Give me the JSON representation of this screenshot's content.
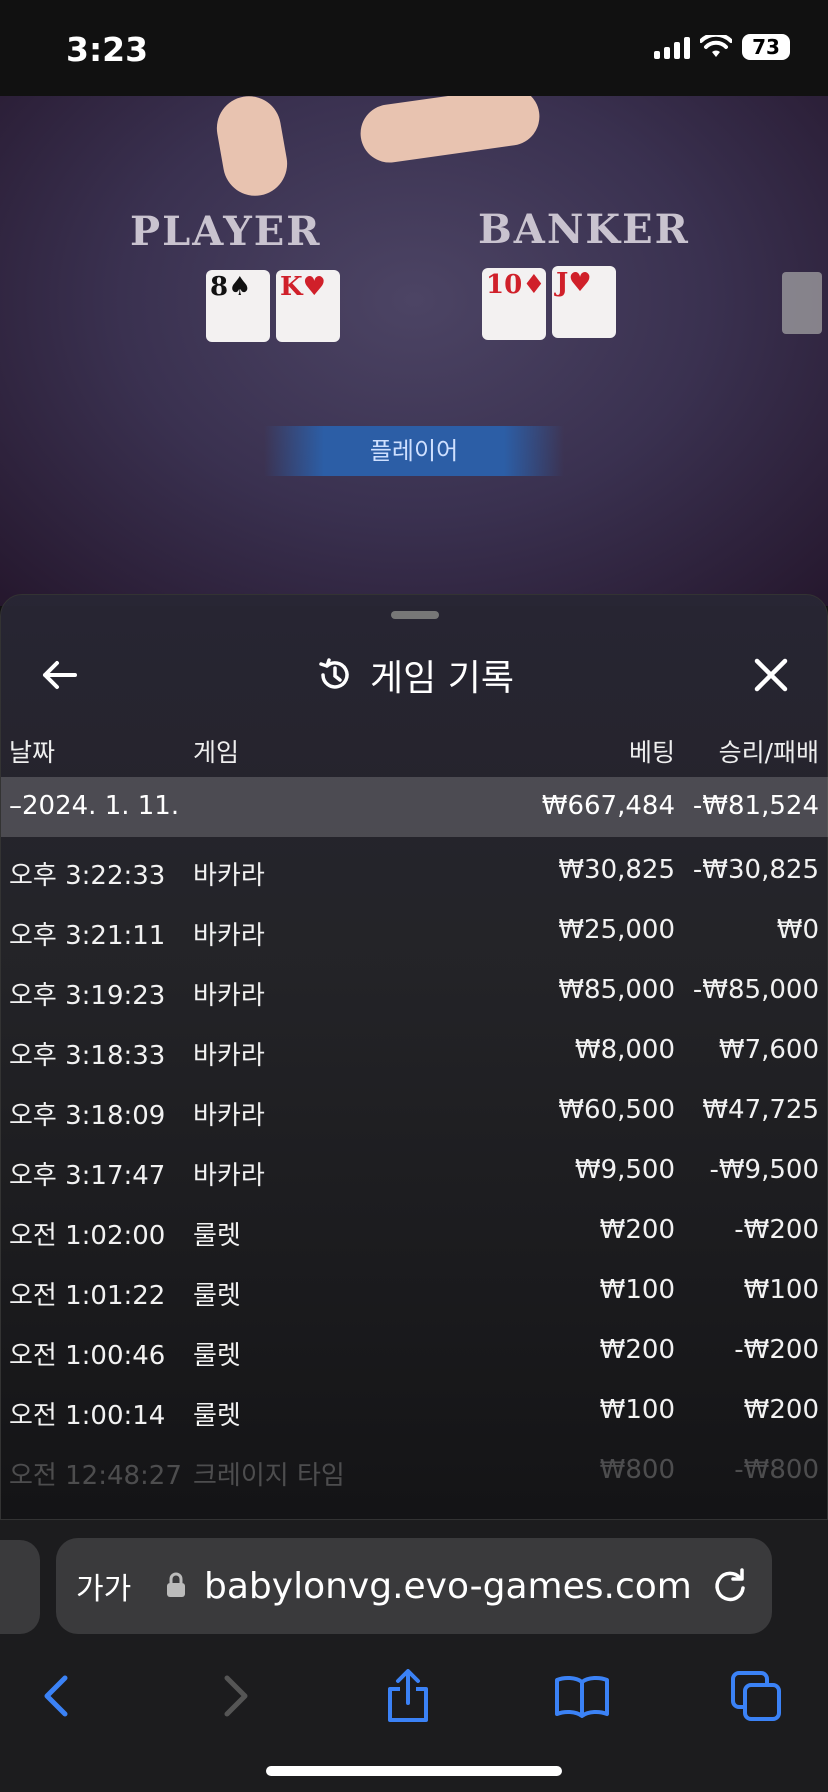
{
  "status": {
    "time": "3:23",
    "battery": "73"
  },
  "video": {
    "player_label": "PLAYER",
    "banker_label": "BANKER",
    "player_cards": [
      {
        "rank": "8",
        "suit": "♠",
        "red": false
      },
      {
        "rank": "K",
        "suit": "♥",
        "red": true
      }
    ],
    "banker_cards": [
      {
        "rank": "10",
        "suit": "♦",
        "red": true
      },
      {
        "rank": "J",
        "suit": "♥",
        "red": true
      }
    ],
    "result": "플레이어"
  },
  "panel": {
    "title": "게임 기록",
    "columns": {
      "date": "날짜",
      "game": "게임",
      "bet": "베팅",
      "winloss": "승리/패배"
    },
    "summary": {
      "date": "–2024. 1. 11.",
      "bet": "₩667,484",
      "winloss": "-₩81,524"
    },
    "rows": [
      {
        "date": "오후 3:22:33",
        "game": "바카라",
        "bet": "₩30,825",
        "winloss": "-₩30,825"
      },
      {
        "date": "오후 3:21:11",
        "game": "바카라",
        "bet": "₩25,000",
        "winloss": "₩0"
      },
      {
        "date": "오후 3:19:23",
        "game": "바카라",
        "bet": "₩85,000",
        "winloss": "-₩85,000"
      },
      {
        "date": "오후 3:18:33",
        "game": "바카라",
        "bet": "₩8,000",
        "winloss": "₩7,600"
      },
      {
        "date": "오후 3:18:09",
        "game": "바카라",
        "bet": "₩60,500",
        "winloss": "₩47,725"
      },
      {
        "date": "오후 3:17:47",
        "game": "바카라",
        "bet": "₩9,500",
        "winloss": "-₩9,500"
      },
      {
        "date": "오전 1:02:00",
        "game": "룰렛",
        "bet": "₩200",
        "winloss": "-₩200"
      },
      {
        "date": "오전 1:01:22",
        "game": "룰렛",
        "bet": "₩100",
        "winloss": "₩100"
      },
      {
        "date": "오전 1:00:46",
        "game": "룰렛",
        "bet": "₩200",
        "winloss": "-₩200"
      },
      {
        "date": "오전 1:00:14",
        "game": "룰렛",
        "bet": "₩100",
        "winloss": "₩200"
      },
      {
        "date": "오전 12:48:27",
        "game": "크레이지 타임",
        "bet": "₩800",
        "winloss": "-₩800"
      }
    ]
  },
  "browser": {
    "text_size_label": "가가",
    "url": "babylonvg.evo-games.com"
  },
  "colors": {
    "accent": "#3b82f6",
    "banner": "#2c5ea6",
    "card_red": "#d0202a"
  }
}
